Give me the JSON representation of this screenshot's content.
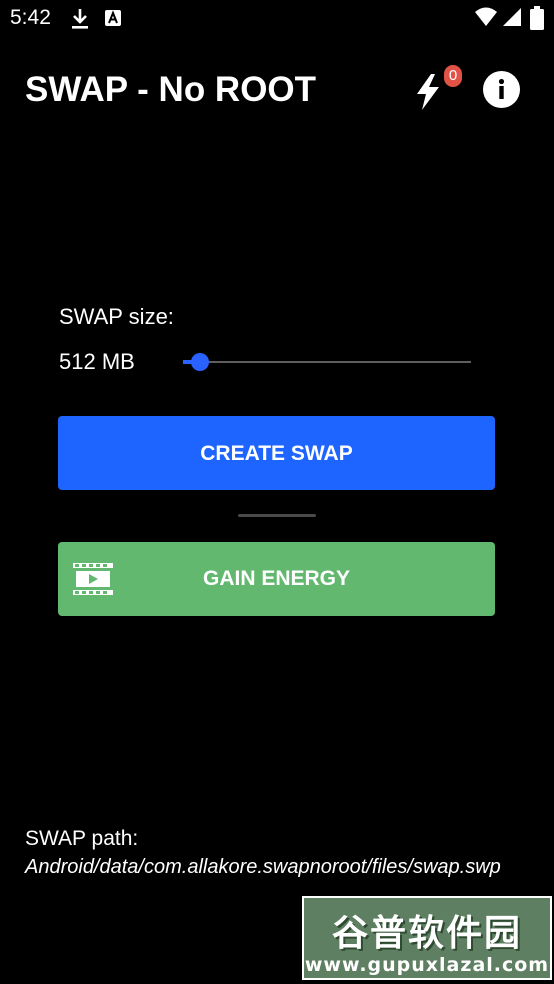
{
  "status_bar": {
    "time": "5:42",
    "icons": [
      "download-icon",
      "a-notification-icon",
      "wifi-icon",
      "signal-icon",
      "battery-icon"
    ]
  },
  "app_bar": {
    "title": "SWAP - No ROOT",
    "energy_badge_count": "0",
    "icons": [
      "lightning-bolt-icon",
      "info-icon"
    ]
  },
  "swap": {
    "size_label": "SWAP size:",
    "size_value": "512 MB",
    "slider_level": 0.06
  },
  "buttons": {
    "create_swap": "CREATE SWAP",
    "gain_energy": "GAIN ENERGY",
    "gain_energy_icon": "video-film-icon"
  },
  "path": {
    "label": "SWAP path:",
    "value": "Android/data/com.allakore.swapnoroot/files/swap.swp"
  },
  "watermark": {
    "top_text": "谷普软件园",
    "bottom_text": "www.gupuxlazal.com"
  },
  "colors": {
    "background": "#000000",
    "accent_blue": "#1e65ff",
    "slider_blue": "#2962ff",
    "gain_energy_green": "#63b86f",
    "badge_red": "#e15247"
  }
}
